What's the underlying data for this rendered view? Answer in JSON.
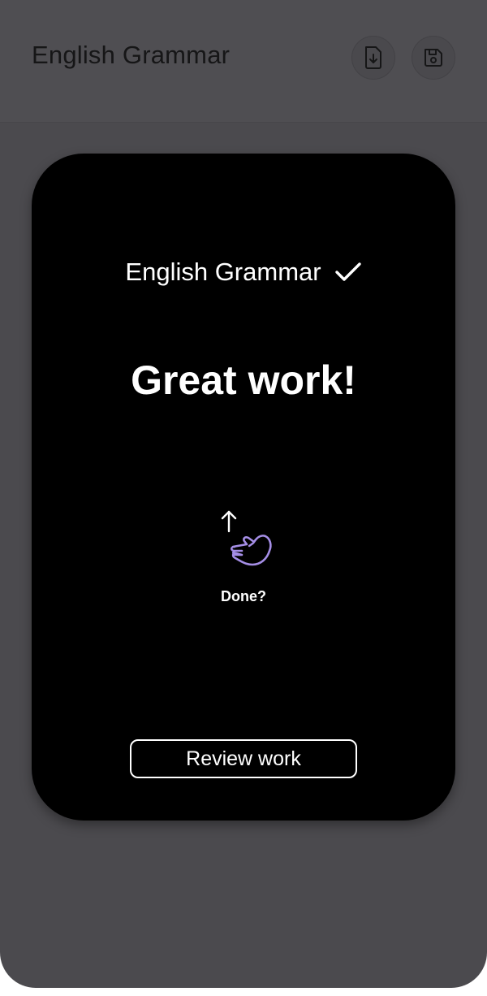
{
  "header": {
    "title": "English Grammar",
    "download_icon": "download-icon",
    "save_icon": "save-icon"
  },
  "card": {
    "heading": "English Grammar",
    "check_icon": "checkmark-icon",
    "headline": "Great work!",
    "gesture_icon": "swipe-up-hand-icon",
    "done_prompt": "Done?",
    "review_button": "Review work"
  },
  "colors": {
    "background": "#4b4a4e",
    "card": "#000000",
    "accent": "#a58ee6",
    "text_light": "#ffffff",
    "text_dark": "#161617"
  }
}
